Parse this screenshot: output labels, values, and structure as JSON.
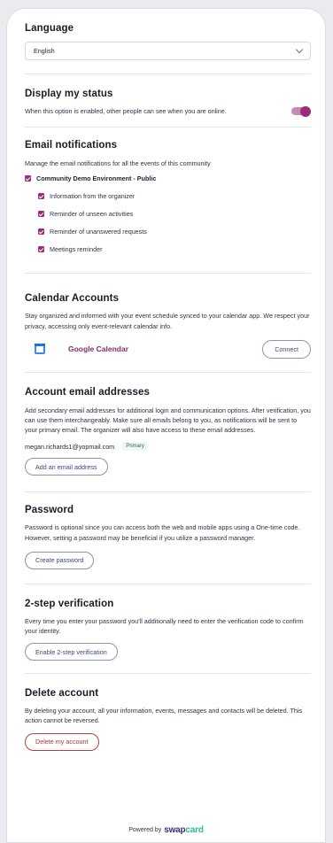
{
  "language": {
    "title": "Language",
    "selected": "English"
  },
  "status": {
    "title": "Display my status",
    "description": "When this option is enabled, other people can see when you are online.",
    "enabled": true
  },
  "email_notifications": {
    "title": "Email notifications",
    "description": "Manage the email notifications for all the events of this community",
    "community": "Community Demo Environment - Public",
    "options": [
      "Information from the organizer",
      "Reminder of unseen activities",
      "Reminder of unanswered requests",
      "Meetings reminder"
    ]
  },
  "calendar": {
    "title": "Calendar Accounts",
    "description": "Stay organized and informed with your event schedule synced to your calendar app. We respect your privacy, accessing only event-relevant calendar info.",
    "provider": "Google Calendar",
    "connect_label": "Connect"
  },
  "emails": {
    "title": "Account email addresses",
    "description": "Add secondary email addresses for additional login and communication options. After verification, you can use them interchangeably. Make sure all emails belong to you, as notifications will be sent to your primary email. The organizer will also have access to these email addresses.",
    "primary_email": "megan.richards1@yopmail.com",
    "primary_badge": "Primary",
    "add_label": "Add an email address"
  },
  "password": {
    "title": "Password",
    "description": "Password is optional since you can access both the web and mobile apps using a One-time code. However, setting a password may be beneficial if you utilize a password manager.",
    "create_label": "Create password"
  },
  "two_step": {
    "title": "2-step verification",
    "description": "Every time you enter your password you'll additionally need to enter the verification code to confirm your identity.",
    "enable_label": "Enable 2-step verification"
  },
  "delete": {
    "title": "Delete account",
    "description": "By deleting your account, all your information, events, messages and contacts will be deleted. This action cannot be reversed.",
    "button_label": "Delete my account"
  },
  "footer": {
    "powered_by": "Powered by",
    "brand_part1": "swap",
    "brand_part2": "card"
  },
  "colors": {
    "accent": "#9b2c7c",
    "danger": "#b7413a",
    "button_text": "#3c4680"
  }
}
